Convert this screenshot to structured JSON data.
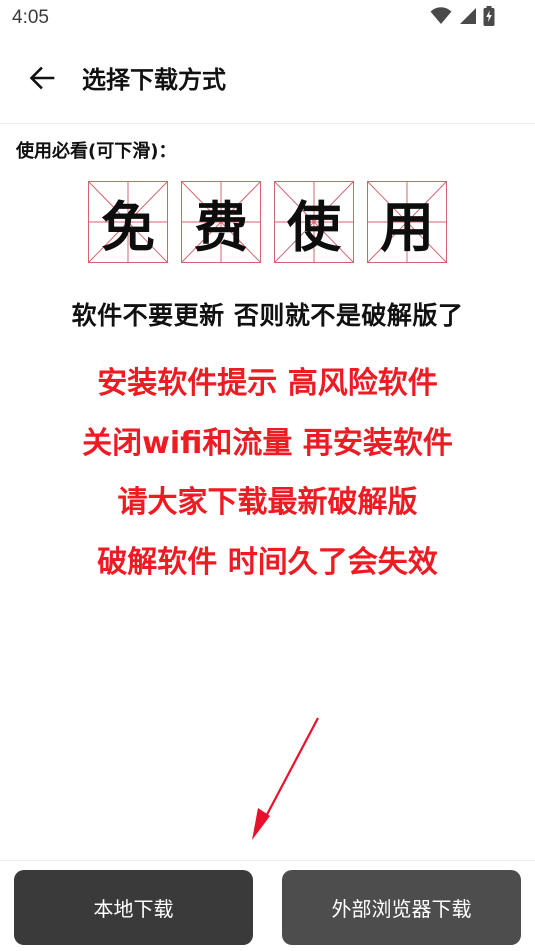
{
  "status": {
    "time": "4:05",
    "icons": [
      "wifi-icon",
      "signal-icon",
      "battery-charging-icon"
    ]
  },
  "header": {
    "back_icon": "arrow-left-icon",
    "title": "选择下载方式"
  },
  "notice": {
    "label": "使用必看(可下滑)：",
    "grid_chars": [
      "免",
      "费",
      "使",
      "用"
    ],
    "line_black": "软件不要更新 否则就不是破解版了",
    "lines_red": [
      "安装软件提示 高风险软件",
      "关闭wifi和流量 再安装软件",
      "请大家下载最新破解版",
      "破解软件 时间久了会失效"
    ]
  },
  "colors": {
    "red_text": "#ee1b23",
    "grid_line": "#d4636c",
    "arrow": "#e8102a",
    "button_dark": "#3b3a3a",
    "button_gray": "#4d4d4d"
  },
  "actions": {
    "local_download": "本地下载",
    "browser_download": "外部浏览器下载"
  }
}
